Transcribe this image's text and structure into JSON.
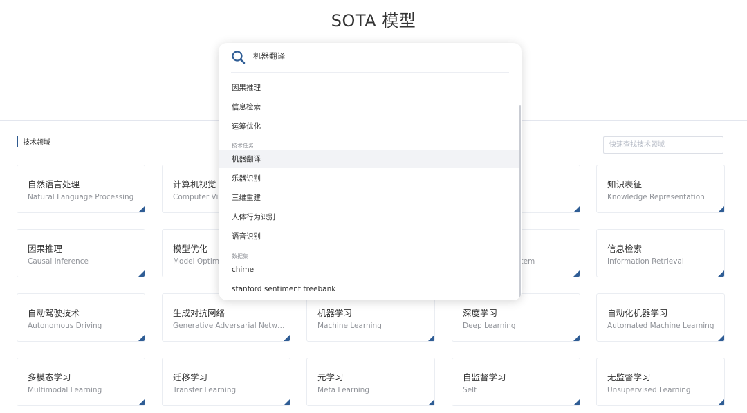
{
  "page": {
    "title": "SOTA 模型"
  },
  "section": {
    "label": "技术领域",
    "quick_search_placeholder": "快速查找技术领域"
  },
  "search": {
    "query": "机器翻译",
    "items_top": [
      "因果推理",
      "信息检索",
      "运筹优化"
    ],
    "group_tasks": "技术任务",
    "tasks": [
      "机器翻译",
      "乐器识别",
      "三维重建",
      "人体行为识别",
      "语音识别"
    ],
    "active_task": "机器翻译",
    "group_datasets": "数据集",
    "datasets": [
      "chime",
      "stanford sentiment treebank"
    ]
  },
  "cards": [
    {
      "zh": "自然语言处理",
      "en": "Natural Language Processing"
    },
    {
      "zh": "计算机视觉",
      "en": "Computer Visi"
    },
    {
      "zh": "",
      "en": ""
    },
    {
      "zh": "",
      "en": ""
    },
    {
      "zh": "知识表征",
      "en": "Knowledge Representation"
    },
    {
      "zh": "因果推理",
      "en": "Causal Inference"
    },
    {
      "zh": "模型优化",
      "en": "Model Optimiz"
    },
    {
      "zh": "",
      "en": ""
    },
    {
      "zh": "",
      "en": "stem"
    },
    {
      "zh": "信息检索",
      "en": "Information Retrieval"
    },
    {
      "zh": "自动驾驶技术",
      "en": "Autonomous Driving"
    },
    {
      "zh": "生成对抗网络",
      "en": "Generative Adversarial Netwo..."
    },
    {
      "zh": "机器学习",
      "en": "Machine Learning"
    },
    {
      "zh": "深度学习",
      "en": "Deep Learning"
    },
    {
      "zh": "自动化机器学习",
      "en": "Automated Machine Learning"
    },
    {
      "zh": "多模态学习",
      "en": "Multimodal Learning"
    },
    {
      "zh": "迁移学习",
      "en": "Transfer Learning"
    },
    {
      "zh": "元学习",
      "en": "Meta Learning"
    },
    {
      "zh": "自监督学习",
      "en": "Self"
    },
    {
      "zh": "无监督学习",
      "en": "Unsupervised Learning"
    }
  ],
  "colors": {
    "accent": "#2f5d95",
    "card_border": "#eaedf2",
    "muted_text": "#909399"
  },
  "icons": {
    "search": "search-icon",
    "card_corner": "corner-triangle-icon"
  }
}
